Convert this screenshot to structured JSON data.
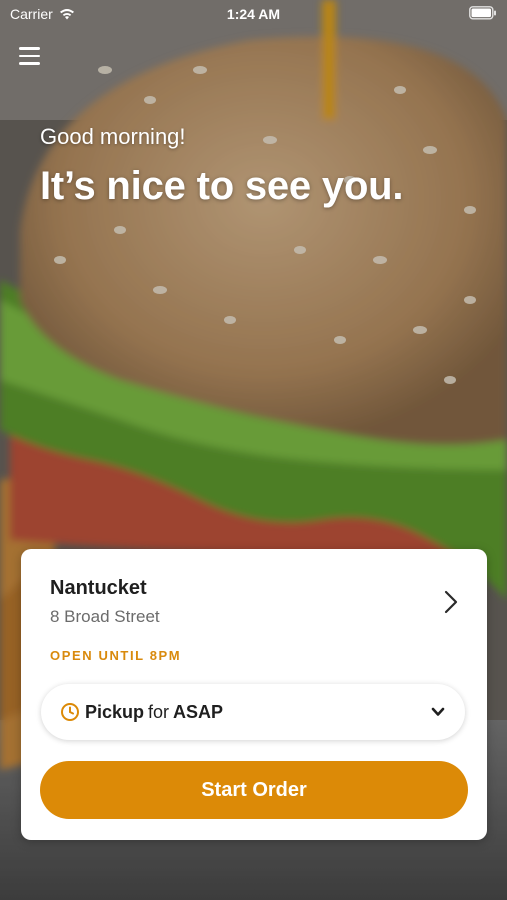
{
  "status_bar": {
    "carrier": "Carrier",
    "time": "1:24 AM"
  },
  "greeting": "Good morning!",
  "headline": "It’s nice to see you.",
  "location": {
    "name": "Nantucket",
    "address": "8 Broad Street",
    "hours": "OPEN UNTIL 8PM"
  },
  "order_mode": {
    "mode": "Pickup",
    "connector": "for",
    "time": "ASAP"
  },
  "start_order_label": "Start Order",
  "colors": {
    "accent": "#dc8a07",
    "hours_text": "#d98a0d"
  },
  "icons": {
    "menu": "hamburger-menu-icon",
    "location_chevron": "chevron-right-icon",
    "clock": "clock-icon",
    "dropdown": "chevron-down-icon"
  }
}
